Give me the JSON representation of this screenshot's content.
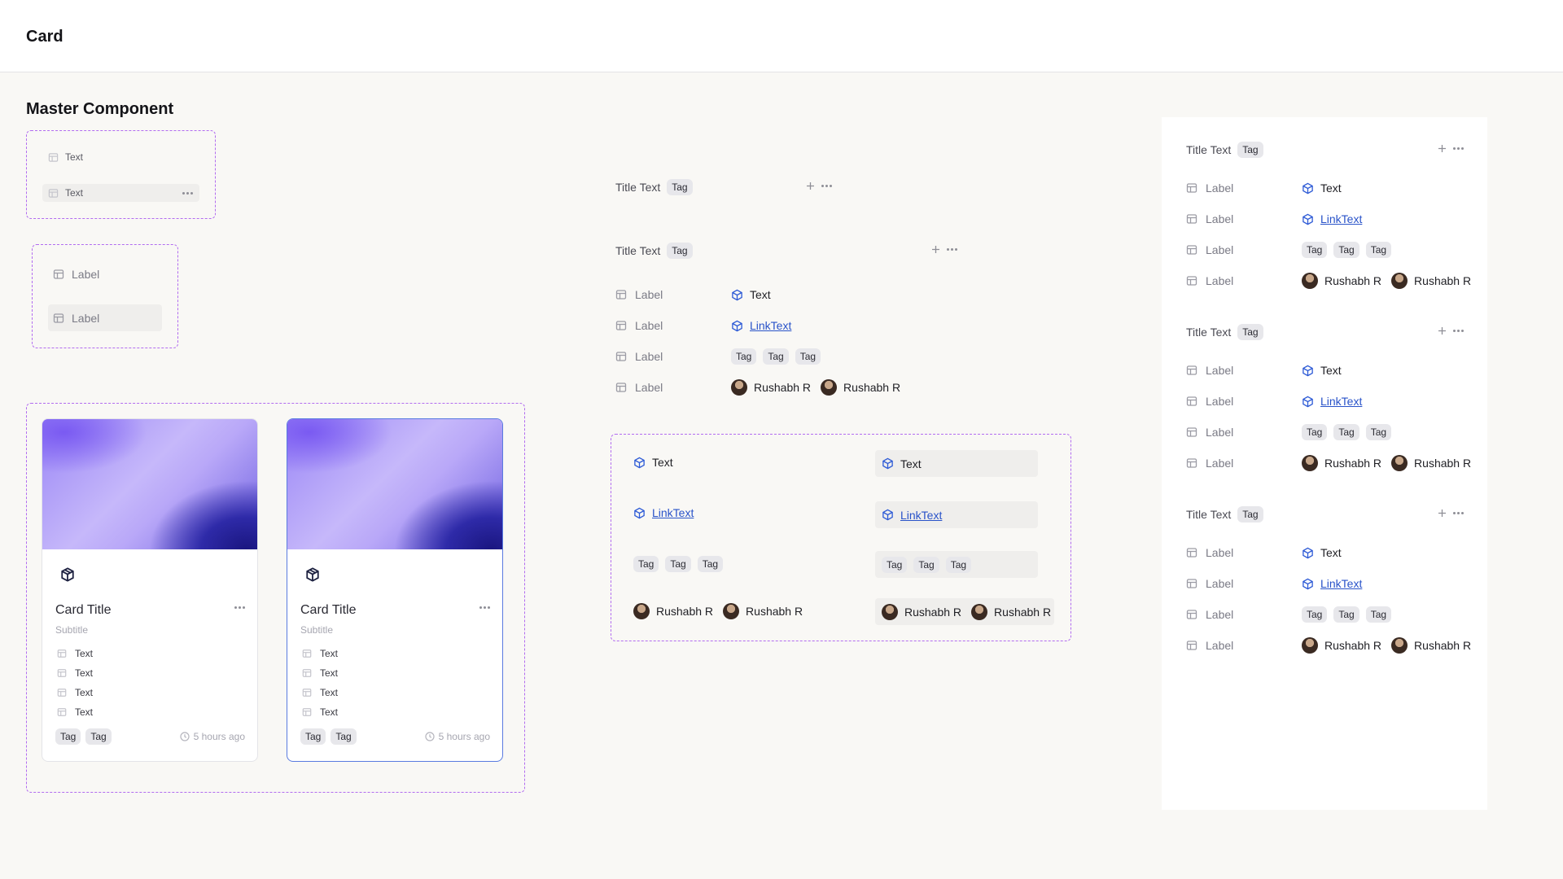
{
  "page": {
    "title": "Card",
    "section_title": "Master Component"
  },
  "icons": {
    "table": "table-icon",
    "cube": "cube-icon",
    "plus": "plus-icon",
    "more": "more-icon",
    "clock": "clock-icon",
    "card_logo": "box-logo-icon"
  },
  "colors": {
    "accent_dash": "#B26CF0",
    "link": "#2953C9",
    "selected_border": "#5A7BE0"
  },
  "text_items": {
    "item1": "Text",
    "item2": "Text"
  },
  "label_items": {
    "item1": "Label",
    "item2": "Label"
  },
  "cards": [
    {
      "title": "Card Title",
      "subtitle": "Subtitle",
      "lines": [
        "Text",
        "Text",
        "Text",
        "Text"
      ],
      "tags": [
        "Tag",
        "Tag"
      ],
      "time": "5 hours ago"
    },
    {
      "title": "Card Title",
      "subtitle": "Subtitle",
      "lines": [
        "Text",
        "Text",
        "Text",
        "Text"
      ],
      "tags": [
        "Tag",
        "Tag"
      ],
      "time": "5 hours ago"
    }
  ],
  "title_row_1": {
    "title": "Title Text",
    "tag": "Tag"
  },
  "property_group": {
    "title": "Title Text",
    "tag": "Tag",
    "rows": [
      {
        "label": "Label",
        "value": "Text"
      },
      {
        "label": "Label",
        "value": "LinkText"
      },
      {
        "label": "Label",
        "tags": [
          "Tag",
          "Tag",
          "Tag"
        ]
      },
      {
        "label": "Label",
        "people": [
          "Rushabh R",
          "Rushabh R"
        ]
      }
    ]
  },
  "value_variants": {
    "text": "Text",
    "link": "LinkText",
    "tags": [
      "Tag",
      "Tag",
      "Tag"
    ],
    "people": [
      "Rushabh R",
      "Rushabh R"
    ]
  },
  "panel_groups": [
    {
      "title": "Title Text",
      "tag": "Tag",
      "rows": [
        {
          "label": "Label",
          "value": "Text"
        },
        {
          "label": "Label",
          "value": "LinkText"
        },
        {
          "label": "Label",
          "tags": [
            "Tag",
            "Tag",
            "Tag"
          ]
        },
        {
          "label": "Label",
          "people": [
            "Rushabh R",
            "Rushabh R"
          ]
        }
      ]
    },
    {
      "title": "Title Text",
      "tag": "Tag",
      "rows": [
        {
          "label": "Label",
          "value": "Text"
        },
        {
          "label": "Label",
          "value": "LinkText"
        },
        {
          "label": "Label",
          "tags": [
            "Tag",
            "Tag",
            "Tag"
          ]
        },
        {
          "label": "Label",
          "people": [
            "Rushabh R",
            "Rushabh R"
          ]
        }
      ]
    },
    {
      "title": "Title Text",
      "tag": "Tag",
      "rows": [
        {
          "label": "Label",
          "value": "Text"
        },
        {
          "label": "Label",
          "value": "LinkText"
        },
        {
          "label": "Label",
          "tags": [
            "Tag",
            "Tag",
            "Tag"
          ]
        },
        {
          "label": "Label",
          "people": [
            "Rushabh R",
            "Rushabh R"
          ]
        }
      ]
    }
  ]
}
